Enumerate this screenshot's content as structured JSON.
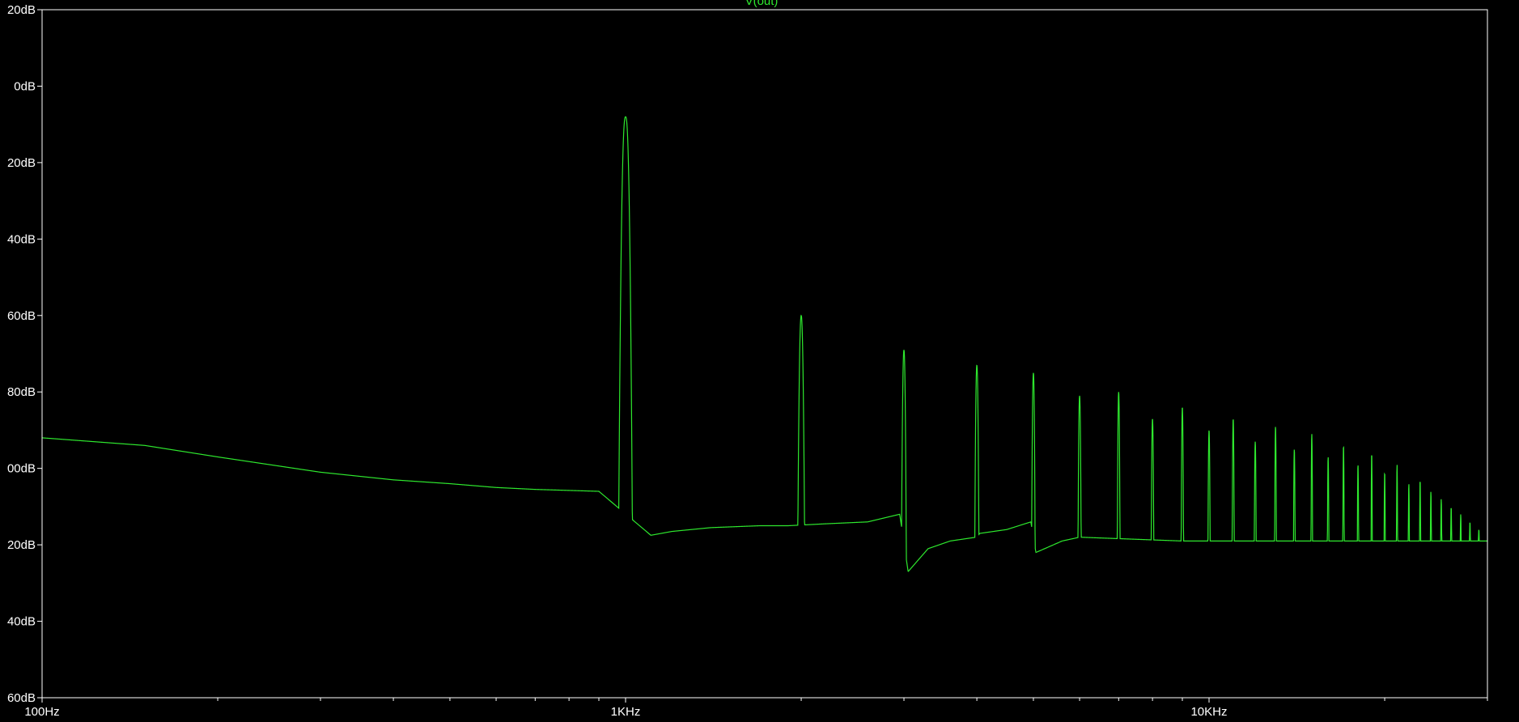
{
  "colors": {
    "background": "#000000",
    "axes": "#ffffff",
    "trace": "#2ee82e"
  },
  "chart_data": {
    "type": "line",
    "title": "V(out)",
    "xlabel": "",
    "ylabel": "",
    "x_scale": "log",
    "xlim": [
      100,
      30000
    ],
    "ylim": [
      -160,
      20
    ],
    "grid": false,
    "x_ticks": [
      {
        "value": 100,
        "label": "100Hz"
      },
      {
        "value": 1000,
        "label": "1KHz"
      },
      {
        "value": 10000,
        "label": "10KHz"
      }
    ],
    "x_minor_ticks": [
      200,
      300,
      400,
      500,
      600,
      700,
      800,
      900,
      2000,
      3000,
      4000,
      5000,
      6000,
      7000,
      8000,
      9000,
      20000,
      30000
    ],
    "y_ticks": [
      {
        "value": 20,
        "label": "20dB"
      },
      {
        "value": 0,
        "label": "0dB"
      },
      {
        "value": -20,
        "label": "20dB"
      },
      {
        "value": -40,
        "label": "40dB"
      },
      {
        "value": -60,
        "label": "60dB"
      },
      {
        "value": -80,
        "label": "80dB"
      },
      {
        "value": -100,
        "label": "00dB"
      },
      {
        "value": -120,
        "label": "20dB"
      },
      {
        "value": -140,
        "label": "40dB"
      },
      {
        "value": -160,
        "label": "60dB"
      }
    ],
    "series": [
      {
        "name": "V(out)",
        "baseline": [
          [
            100,
            -92
          ],
          [
            150,
            -94
          ],
          [
            200,
            -97
          ],
          [
            300,
            -101
          ],
          [
            400,
            -103
          ],
          [
            500,
            -104
          ],
          [
            600,
            -105
          ],
          [
            700,
            -105.5
          ],
          [
            900,
            -106
          ],
          [
            1105,
            -117.5
          ],
          [
            1200,
            -116.5
          ],
          [
            1400,
            -115.5
          ],
          [
            1700,
            -115
          ],
          [
            1900,
            -115
          ],
          [
            2200,
            -114.5
          ],
          [
            2600,
            -114
          ],
          [
            2950,
            -112
          ],
          [
            3050,
            -127
          ],
          [
            3300,
            -121
          ],
          [
            3600,
            -119
          ],
          [
            3990,
            -118
          ],
          [
            4050,
            -117
          ],
          [
            4500,
            -116
          ],
          [
            4950,
            -114
          ],
          [
            5050,
            -122
          ],
          [
            5600,
            -119
          ],
          [
            6000,
            -118
          ],
          [
            9000,
            -119
          ],
          [
            12000,
            -119
          ],
          [
            20000,
            -119
          ],
          [
            30000,
            -119
          ]
        ],
        "peaks": [
          {
            "f": 1000,
            "db": -8,
            "half_width_octaves": 0.0385,
            "shape": 2.5
          },
          {
            "f": 2000,
            "db": -60,
            "half_width_octaves": 0.0189,
            "shape": 2.2
          },
          {
            "f": 3000,
            "db": -69,
            "half_width_octaves": 0.0135,
            "shape": 2.2
          },
          {
            "f": 4000,
            "db": -73,
            "half_width_octaves": 0.0115,
            "shape": 2.2
          },
          {
            "f": 5000,
            "db": -75,
            "half_width_octaves": 0.0098,
            "shape": 2.2
          },
          {
            "f": 6000,
            "db": -81,
            "half_width_octaves": 0.0087,
            "shape": 2.2
          },
          {
            "f": 7000,
            "db": -80,
            "half_width_octaves": 0.0075,
            "shape": 2.2
          },
          {
            "f": 8000,
            "db": -87,
            "half_width_octaves": 0.007,
            "shape": 2.2
          },
          {
            "f": 9000,
            "db": -84,
            "half_width_octaves": 0.0065,
            "shape": 2.2
          },
          {
            "f": 10000,
            "db": -90,
            "half_width_octaves": 0.006,
            "shape": 2.2
          },
          {
            "f": 11000,
            "db": -87,
            "half_width_octaves": 0.0056,
            "shape": 2.2
          },
          {
            "f": 12000,
            "db": -93,
            "half_width_octaves": 0.0052,
            "shape": 2.2
          },
          {
            "f": 13000,
            "db": -89,
            "half_width_octaves": 0.0048,
            "shape": 2.2
          },
          {
            "f": 14000,
            "db": -95,
            "half_width_octaves": 0.0045,
            "shape": 2.2
          },
          {
            "f": 15000,
            "db": -91,
            "half_width_octaves": 0.0043,
            "shape": 2.2
          },
          {
            "f": 16000,
            "db": -97,
            "half_width_octaves": 0.004,
            "shape": 2.2
          },
          {
            "f": 17000,
            "db": -94,
            "half_width_octaves": 0.0038,
            "shape": 2.2
          },
          {
            "f": 18000,
            "db": -99,
            "half_width_octaves": 0.0036,
            "shape": 2.2
          },
          {
            "f": 19000,
            "db": -96,
            "half_width_octaves": 0.0034,
            "shape": 2.2
          },
          {
            "f": 20000,
            "db": -101,
            "half_width_octaves": 0.0033,
            "shape": 2.2
          },
          {
            "f": 21000,
            "db": -99,
            "half_width_octaves": 0.0031,
            "shape": 2.2
          },
          {
            "f": 22000,
            "db": -104,
            "half_width_octaves": 0.003,
            "shape": 2.2
          },
          {
            "f": 23000,
            "db": -103,
            "half_width_octaves": 0.0029,
            "shape": 2.2
          },
          {
            "f": 24000,
            "db": -106,
            "half_width_octaves": 0.0028,
            "shape": 2.2
          },
          {
            "f": 25000,
            "db": -108,
            "half_width_octaves": 0.0027,
            "shape": 2.2
          },
          {
            "f": 26000,
            "db": -110,
            "half_width_octaves": 0.0026,
            "shape": 2.2
          },
          {
            "f": 27000,
            "db": -112,
            "half_width_octaves": 0.0025,
            "shape": 2.2
          },
          {
            "f": 28000,
            "db": -114,
            "half_width_octaves": 0.0024,
            "shape": 2.2
          },
          {
            "f": 29000,
            "db": -116,
            "half_width_octaves": 0.0023,
            "shape": 2.2
          }
        ]
      }
    ]
  }
}
